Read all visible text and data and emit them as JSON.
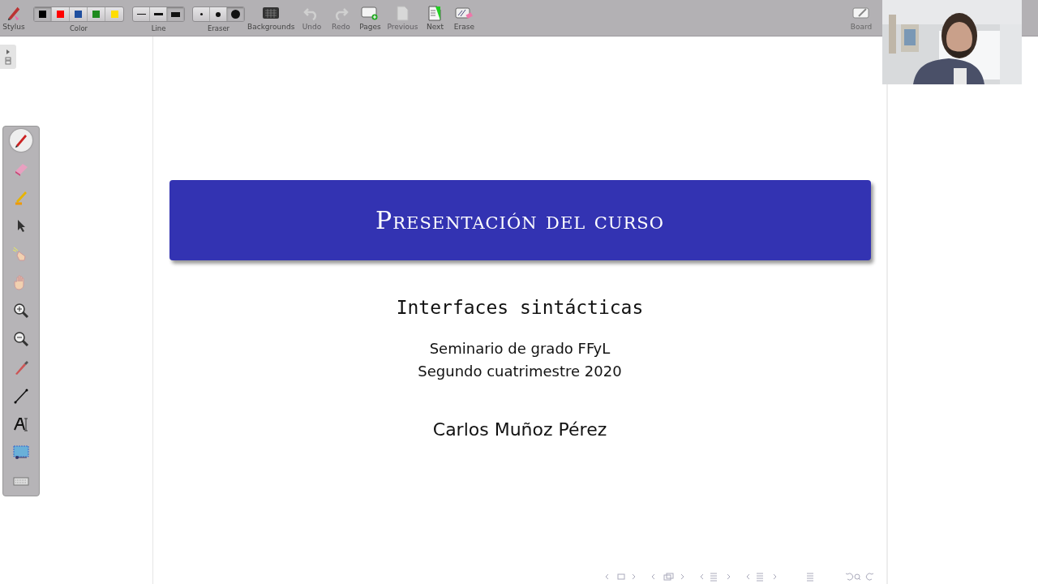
{
  "toolbar": {
    "stylus": {
      "label": "Stylus"
    },
    "color": {
      "label": "Color",
      "swatches": [
        {
          "color": "#000000",
          "selected": true
        },
        {
          "color": "#ff0000",
          "selected": false
        },
        {
          "color": "#1f4f9f",
          "selected": false
        },
        {
          "color": "#1e8a1e",
          "selected": false
        },
        {
          "color": "#ffdd00",
          "selected": false
        }
      ]
    },
    "line": {
      "label": "Line",
      "widths": [
        {
          "selected": false
        },
        {
          "selected": false
        },
        {
          "selected": true
        }
      ]
    },
    "eraser": {
      "label": "Eraser",
      "sizes": [
        {
          "selected": false
        },
        {
          "selected": false
        },
        {
          "selected": true
        }
      ]
    },
    "actions": [
      {
        "kind": "backgrounds",
        "label": "Backgrounds",
        "disabled": false
      },
      {
        "kind": "undo",
        "label": "Undo",
        "disabled": true
      },
      {
        "kind": "redo",
        "label": "Redo",
        "disabled": true
      },
      {
        "kind": "pages",
        "label": "Pages",
        "disabled": false
      },
      {
        "kind": "previous",
        "label": "Previous",
        "disabled": true
      },
      {
        "kind": "next",
        "label": "Next",
        "disabled": false
      },
      {
        "kind": "erase",
        "label": "Erase",
        "disabled": false
      }
    ],
    "board": {
      "label": "Board"
    }
  },
  "tools": [
    {
      "kind": "pen",
      "selected": true
    },
    {
      "kind": "eraser",
      "selected": false
    },
    {
      "kind": "marker",
      "selected": false
    },
    {
      "kind": "pointer",
      "selected": false
    },
    {
      "kind": "laser",
      "selected": false
    },
    {
      "kind": "hand",
      "selected": false
    },
    {
      "kind": "zoomin",
      "selected": false
    },
    {
      "kind": "zoomout",
      "selected": false
    },
    {
      "kind": "picker",
      "selected": false
    },
    {
      "kind": "line",
      "selected": false
    },
    {
      "kind": "text",
      "selected": false
    },
    {
      "kind": "capture",
      "selected": false
    },
    {
      "kind": "keyboard",
      "selected": false
    }
  ],
  "slide": {
    "title": "Presentación del curso",
    "subtitle": "Interfaces sintácticas",
    "info": [
      "Seminario de grado FFyL",
      "Segundo cuatrimestre 2020"
    ],
    "author": "Carlos Muñoz Pérez"
  }
}
